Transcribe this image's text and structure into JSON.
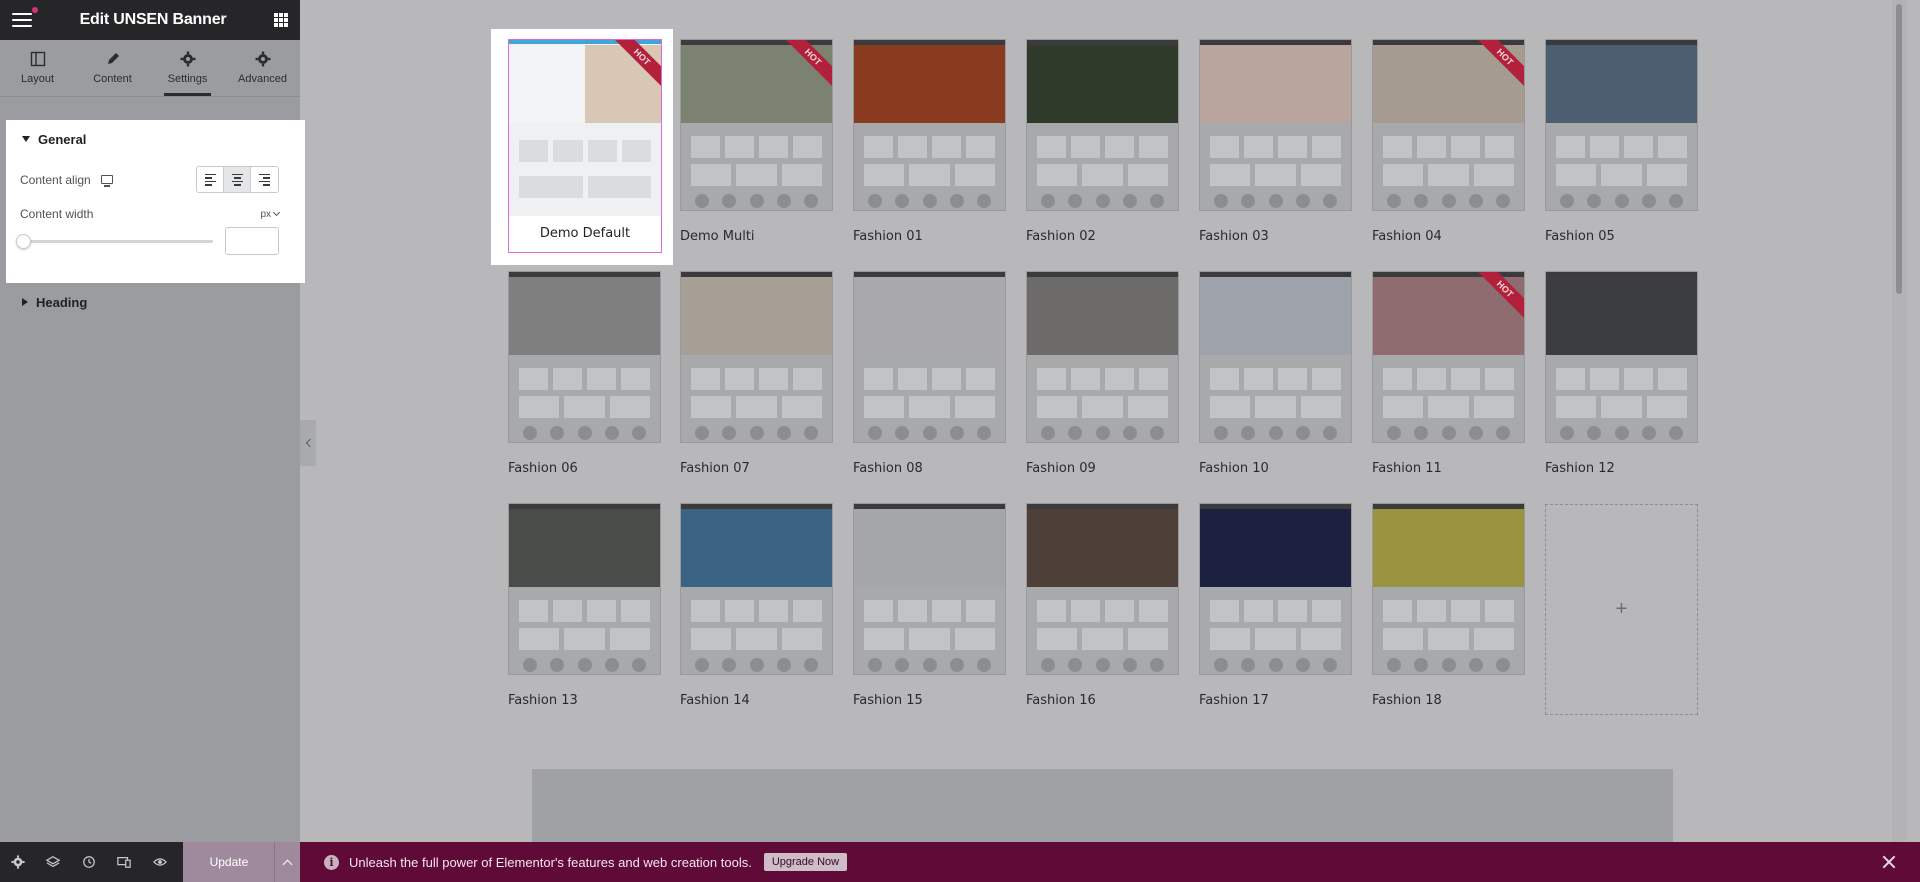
{
  "panel": {
    "title": "Edit UNSEN Banner",
    "tabs": [
      {
        "label": "Layout",
        "icon": "layout-icon"
      },
      {
        "label": "Content",
        "icon": "pencil-icon"
      },
      {
        "label": "Settings",
        "icon": "gear-icon",
        "active": true
      },
      {
        "label": "Advanced",
        "icon": "gear-icon"
      }
    ],
    "general": {
      "title": "General",
      "content_align_label": "Content align",
      "content_width_label": "Content width",
      "unit": "px",
      "width_value": ""
    },
    "heading": {
      "title": "Heading"
    }
  },
  "footer": {
    "update_label": "Update"
  },
  "promo": {
    "message": "Unleash the full power of Elementor's features and web creation tools.",
    "button": "Upgrade Now"
  },
  "hot_label": "HOT",
  "demos": [
    {
      "label": "Demo Default",
      "hot": true,
      "selected": true,
      "accent": "#f1f2f4"
    },
    {
      "label": "Demo Multi",
      "hot": true,
      "accent": "#7b8270"
    },
    {
      "label": "Fashion 01",
      "accent": "#8a3a1e"
    },
    {
      "label": "Fashion 02",
      "accent": "#2f3a2a"
    },
    {
      "label": "Fashion 03",
      "accent": "#b9a59d"
    },
    {
      "label": "Fashion 04",
      "hot": true,
      "accent": "#a69b90"
    },
    {
      "label": "Fashion 05",
      "accent": "#4b5f70"
    },
    {
      "label": "Fashion 06",
      "accent": "#7f7f80"
    },
    {
      "label": "Fashion 07",
      "accent": "#a59f96"
    },
    {
      "label": "Fashion 08",
      "accent": "#a9a9ab"
    },
    {
      "label": "Fashion 09",
      "accent": "#6d6b6a"
    },
    {
      "label": "Fashion 10",
      "accent": "#9ea3ab"
    },
    {
      "label": "Fashion 11",
      "hot": true,
      "accent": "#8e6c6f"
    },
    {
      "label": "Fashion 12",
      "accent": "#3b3d40"
    },
    {
      "label": "Fashion 13",
      "accent": "#4a4c4a"
    },
    {
      "label": "Fashion 14",
      "accent": "#3a6383"
    },
    {
      "label": "Fashion 15",
      "accent": "#a4a6aa"
    },
    {
      "label": "Fashion 16",
      "accent": "#4f3f39"
    },
    {
      "label": "Fashion 17",
      "accent": "#1c2140"
    },
    {
      "label": "Fashion 18",
      "accent": "#9a9440"
    }
  ],
  "add_symbol": "+"
}
